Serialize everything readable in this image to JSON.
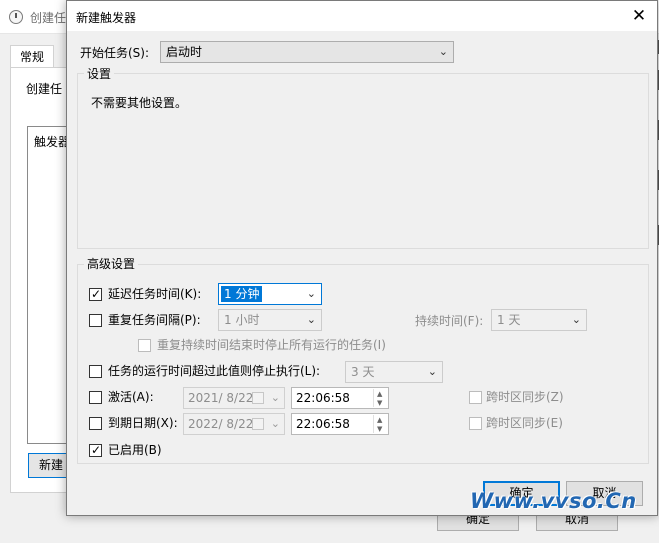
{
  "background_window": {
    "title": "创建任",
    "tab_general": "常规",
    "description_fragment": "创建任",
    "trigger_list_header": "触发器",
    "new_button": "新建",
    "ok_button": "确定",
    "cancel_button": "取消"
  },
  "dialog": {
    "title": "新建触发器",
    "close_glyph": "✕",
    "start_task_label": "开始任务(S):",
    "start_task_value": "启动时",
    "settings_title": "设置",
    "settings_text": "不需要其他设置。",
    "advanced_title": "高级设置",
    "delay": {
      "label": "延迟任务时间(K):",
      "checked": true,
      "value": "1 分钟"
    },
    "repeat": {
      "label": "重复任务间隔(P):",
      "checked": false,
      "value": "1 小时",
      "duration_label": "持续时间(F):",
      "duration_value": "1 天"
    },
    "stop_all": {
      "label": "重复持续时间结束时停止所有运行的任务(I)",
      "checked": false
    },
    "stop_if_longer": {
      "label": "任务的运行时间超过此值则停止执行(L):",
      "checked": false,
      "value": "3 天"
    },
    "activate": {
      "label": "激活(A):",
      "checked": false,
      "date": "2021/ 8/22",
      "time": "22:06:58",
      "sync_label": "跨时区同步(Z)"
    },
    "expire": {
      "label": "到期日期(X):",
      "checked": false,
      "date": "2022/ 8/22",
      "time": "22:06:58",
      "sync_label": "跨时区同步(E)"
    },
    "enabled": {
      "label": "已启用(B)",
      "checked": true
    },
    "ok_button": "确定",
    "cancel_button": "取消"
  },
  "watermark": "Www.vvso.Cn",
  "glyphs": {
    "check": "✓",
    "dropdown": "⌄",
    "spin_up": "▲",
    "spin_down": "▼"
  },
  "colors": {
    "accent": "#0078d7",
    "dialog_bg": "#f0f0f0",
    "disabled_text": "#8d8d8d"
  }
}
